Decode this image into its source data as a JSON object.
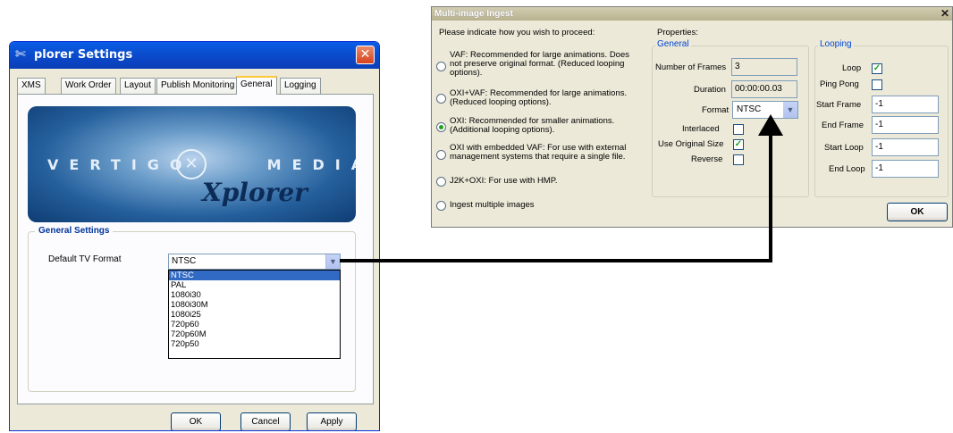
{
  "xp_dialog": {
    "title": "plorer Settings",
    "close_label": "✕",
    "tabs": [
      "XMS",
      "Work Order",
      "Layout",
      "Publish Monitoring",
      "General",
      "Logging"
    ],
    "active_tab": "General",
    "banner": {
      "logo_left": "VERTIGO",
      "logo_right": "MEDIA",
      "logo_mark": "✕",
      "product": "Xplorer"
    },
    "group_label": "General Settings",
    "tv_format": {
      "label": "Default TV Format",
      "value": "NTSC",
      "options": [
        "NTSC",
        "PAL",
        "1080i30",
        "1080i30M",
        "1080i25",
        "720p60",
        "720p60M",
        "720p50"
      ]
    },
    "buttons": {
      "ok": "OK",
      "cancel": "Cancel",
      "apply": "Apply"
    }
  },
  "ingest_dialog": {
    "title": "Multi-image Ingest",
    "close_label": "✕",
    "prompt": "Please indicate how you wish to proceed:",
    "options": [
      {
        "text": "VAF: Recommended for large animations. Does not preserve original format. (Reduced looping options).",
        "selected": false
      },
      {
        "text": "OXI+VAF: Recommended for large animations. (Reduced looping options).",
        "selected": false
      },
      {
        "text": "OXI: Recommended for smaller animations. (Additional looping options).",
        "selected": true
      },
      {
        "text": "OXI with embedded VAF: For use with external management systems that require a single file.",
        "selected": false
      },
      {
        "text": "J2K+OXI: For use with HMP.",
        "selected": false
      },
      {
        "text": "Ingest multiple images",
        "selected": false
      }
    ],
    "properties_label": "Properties:",
    "general": {
      "label": "General",
      "number_of_frames_label": "Number of Frames",
      "number_of_frames": "3",
      "duration_label": "Duration",
      "duration": "00:00:00.03",
      "format_label": "Format",
      "format": "NTSC",
      "interlaced_label": "Interlaced",
      "interlaced": false,
      "use_original_size_label": "Use Original Size",
      "use_original_size": true,
      "reverse_label": "Reverse",
      "reverse": false
    },
    "looping": {
      "label": "Looping",
      "loop_label": "Loop",
      "loop": true,
      "ping_pong_label": "Ping Pong",
      "ping_pong": false,
      "start_frame_label": "Start Frame",
      "start_frame": "-1",
      "end_frame_label": "End Frame",
      "end_frame": "-1",
      "start_loop_label": "Start Loop",
      "start_loop": "-1",
      "end_loop_label": "End Loop",
      "end_loop": "-1"
    },
    "ok_label": "OK"
  },
  "colors": {
    "xp_title": "#0a4fd0",
    "selection": "#316ac5",
    "group_label": "#003399",
    "ingest_title": "#b8b190",
    "checkmark": "#21a121"
  }
}
